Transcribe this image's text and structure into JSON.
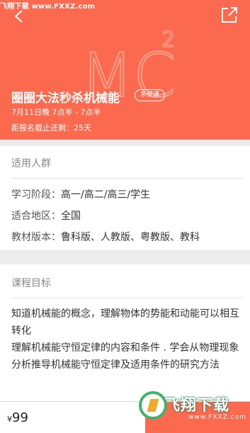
{
  "header": {
    "site_watermark": "飞翔下载 www.FXXZ.com",
    "logo_text": "MC",
    "logo_sup": "2",
    "course_title": "圈圈大法秒杀机械能",
    "course_badge": "系统课",
    "course_time": "7月11日晚 7点半 - 7点半",
    "countdown": "距报名截止还剩：25天",
    "background_color": "#fb6a4e"
  },
  "audience": {
    "section_title": "适用人群",
    "rows": [
      {
        "label": "学习阶段：",
        "value": "高一/高二/高三/学生"
      },
      {
        "label": "适合地区：",
        "value": "全国"
      },
      {
        "label": "教材版本：",
        "value": "鲁科版、人教版、粤教版、教科"
      }
    ]
  },
  "goals": {
    "section_title": "课程目标",
    "text": "知道机械能的概念，理解物体的势能和动能可以相互转化\n理解机械能守恒定律的内容和条件 . 学会从物理现象分析推导机械能守恒定律及适用条件的研究方法"
  },
  "footer": {
    "price_symbol": "¥",
    "price_value": "99",
    "site_logo_text": "飞翔下载",
    "site_logo_url": "www.FXXZ.com"
  },
  "icons": {
    "back": "back-arrow-icon",
    "share": "share-icon"
  }
}
